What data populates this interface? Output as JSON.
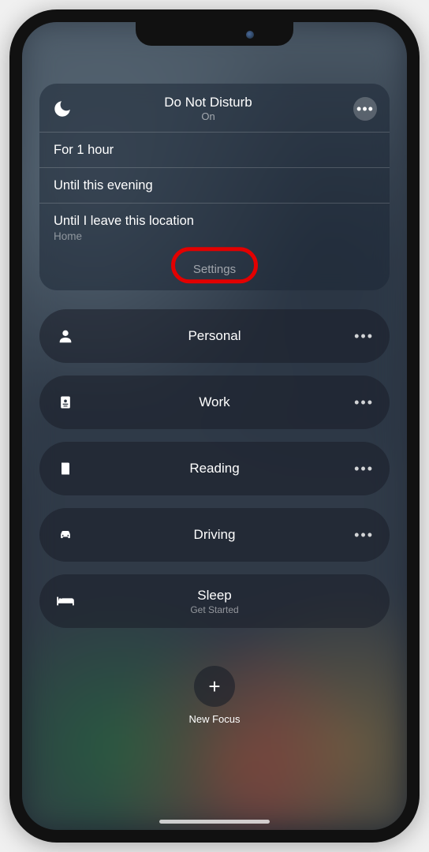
{
  "dnd": {
    "title": "Do Not Disturb",
    "status": "On",
    "options": [
      {
        "label": "For 1 hour",
        "sub": ""
      },
      {
        "label": "Until this evening",
        "sub": ""
      },
      {
        "label": "Until I leave this location",
        "sub": "Home"
      }
    ],
    "settings_label": "Settings"
  },
  "focus_modes": [
    {
      "icon": "person",
      "label": "Personal",
      "sub": "",
      "more": true
    },
    {
      "icon": "badge",
      "label": "Work",
      "sub": "",
      "more": true
    },
    {
      "icon": "book",
      "label": "Reading",
      "sub": "",
      "more": true
    },
    {
      "icon": "car",
      "label": "Driving",
      "sub": "",
      "more": true
    },
    {
      "icon": "bed",
      "label": "Sleep",
      "sub": "Get Started",
      "more": false
    }
  ],
  "new_focus": {
    "label": "New Focus",
    "plus": "+"
  },
  "annotation": {
    "highlight_target": "settings-link",
    "color": "#e30000"
  }
}
